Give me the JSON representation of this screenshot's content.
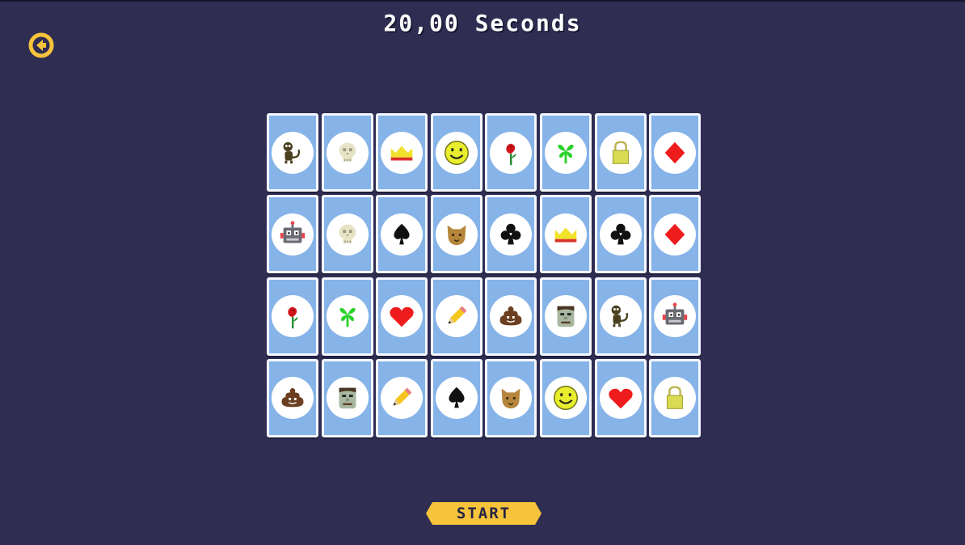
{
  "timer": {
    "text": "20,00 Seconds"
  },
  "back": {
    "icon": "arrow-left-circle-icon",
    "color": "#f6c33a"
  },
  "start": {
    "label": "START",
    "color": "#f6c33a"
  },
  "colors": {
    "background": "#2f2d52",
    "card_back": "#86b3e8",
    "card_border": "#f4f7ff"
  },
  "cards": [
    "monkey",
    "skull",
    "crown",
    "smiley",
    "rose",
    "flower",
    "lock",
    "diamond",
    "robot",
    "skull",
    "spade",
    "cat",
    "club",
    "crown",
    "club",
    "diamond",
    "rose",
    "flower",
    "heart",
    "pencil",
    "poop",
    "zombie",
    "monkey",
    "robot",
    "poop",
    "zombie",
    "pencil",
    "spade",
    "cat",
    "smiley",
    "heart",
    "lock"
  ]
}
